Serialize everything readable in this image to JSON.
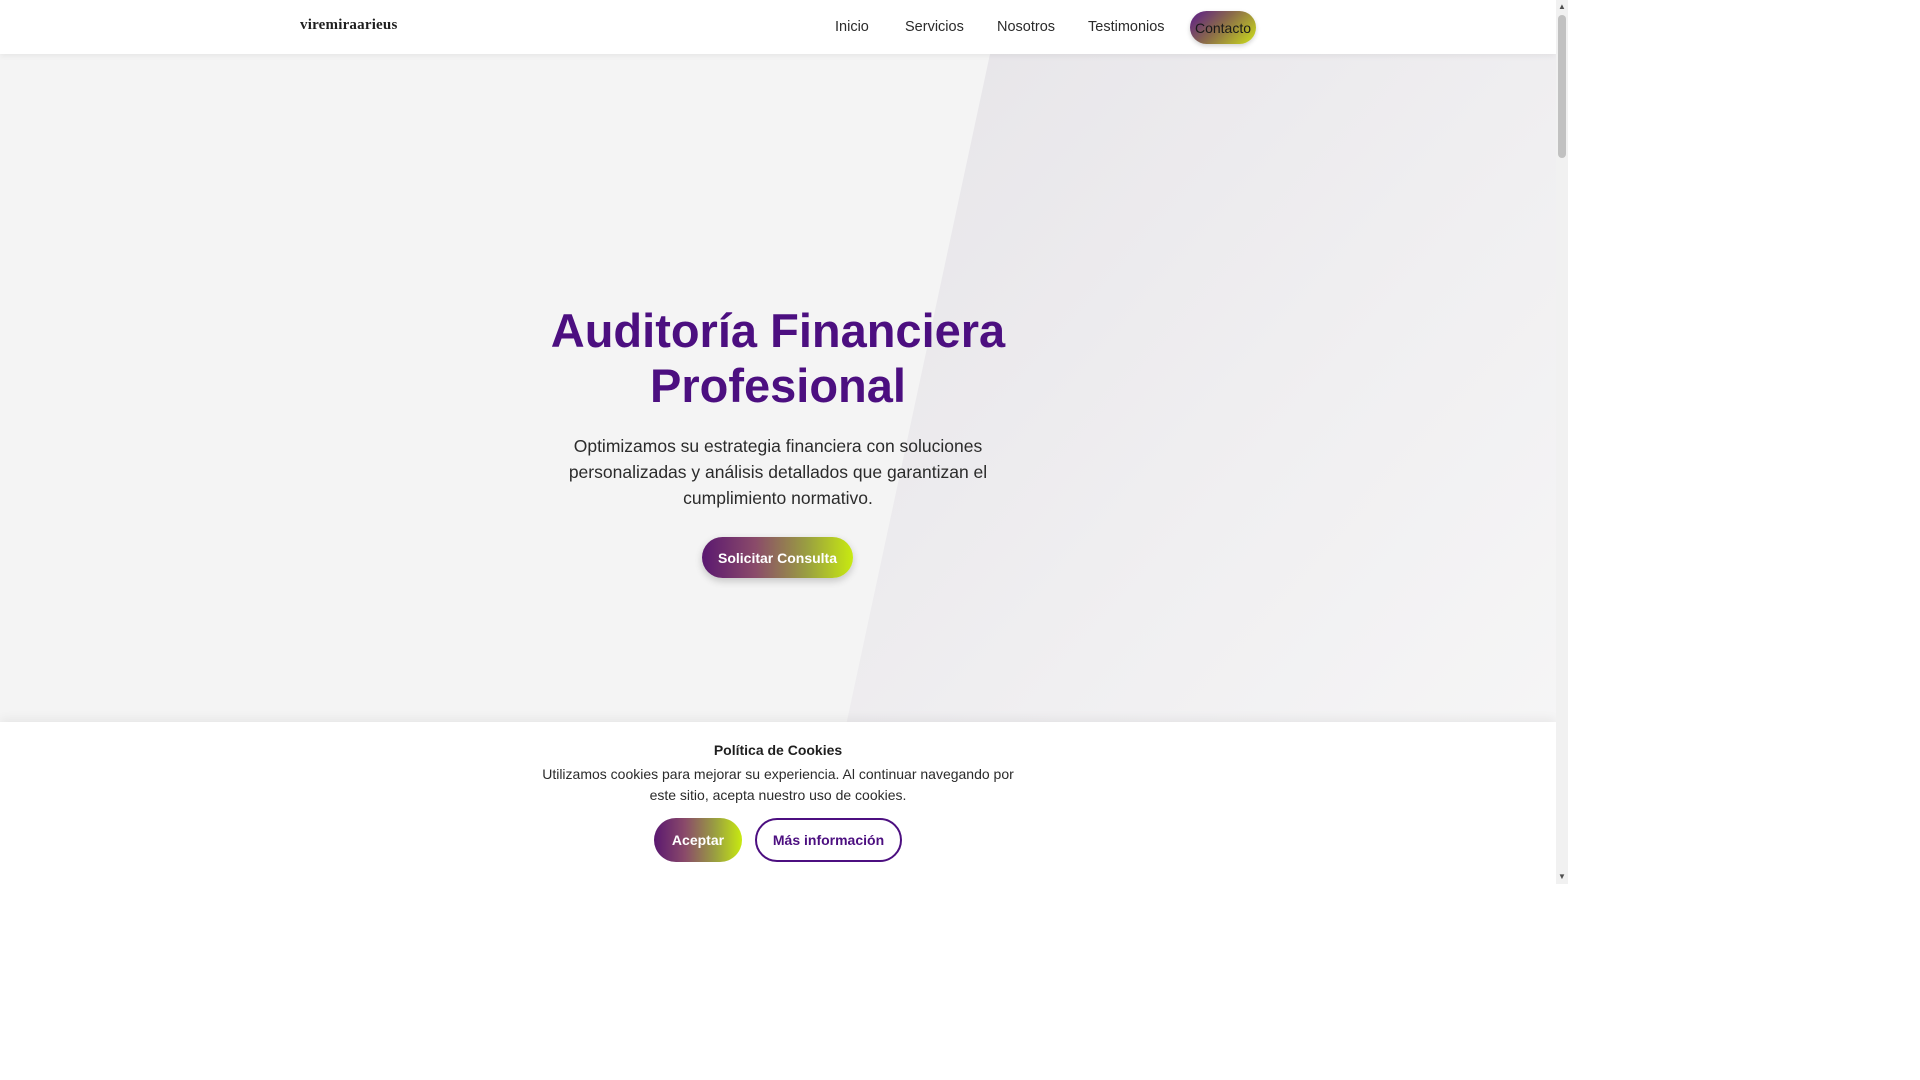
{
  "header": {
    "logo": "viremiraarieus",
    "nav": [
      {
        "label": "Inicio"
      },
      {
        "label": "Servicios"
      },
      {
        "label": "Nosotros"
      },
      {
        "label": "Testimonios"
      }
    ],
    "contact_label": "Contacto"
  },
  "hero": {
    "title_line1": "Auditoría Financiera",
    "title_line2": "Profesional",
    "subtitle": "Optimizamos su estrategia financiera con soluciones personalizadas y análisis detallados que garantizan el cumplimiento normativo.",
    "cta_label": "Solicitar Consulta"
  },
  "cookie_banner": {
    "title": "Política de Cookies",
    "text": "Utilizamos cookies para mejorar su experiencia. Al continuar navegando por este sitio, acepta nuestro uso de cookies.",
    "accept_label": "Aceptar",
    "more_label": "Más información"
  },
  "colors": {
    "primary": "#4c0f80",
    "accent": "#c8ea10",
    "hero_background": "#f4f4f4"
  },
  "icons": {
    "scroll_up": "triangle-up-icon",
    "scroll_down": "triangle-down-icon"
  }
}
